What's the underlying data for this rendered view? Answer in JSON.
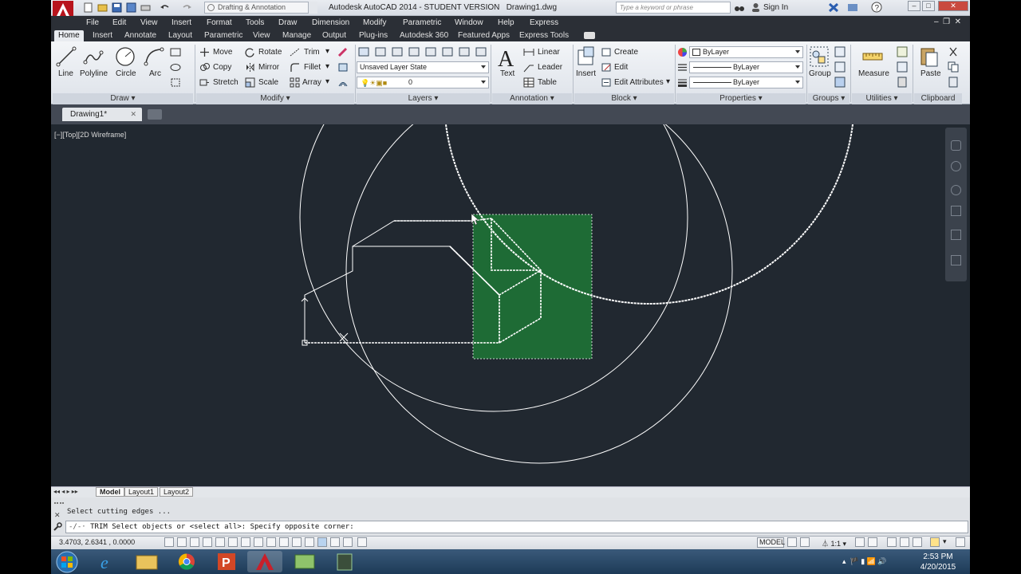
{
  "titlebar": {
    "workspace": "Drafting & Annotation",
    "app_title": "Autodesk AutoCAD 2014 - STUDENT VERSION",
    "file_name": "Drawing1.dwg",
    "search_placeholder": "Type a keyword or phrase",
    "sign_in": "Sign In"
  },
  "menubar": [
    "File",
    "Edit",
    "View",
    "Insert",
    "Format",
    "Tools",
    "Draw",
    "Dimension",
    "Modify",
    "Parametric",
    "Window",
    "Help",
    "Express"
  ],
  "ribbon_tabs": [
    "Home",
    "Insert",
    "Annotate",
    "Layout",
    "Parametric",
    "View",
    "Manage",
    "Output",
    "Plug-ins",
    "Autodesk 360",
    "Featured Apps",
    "Express Tools"
  ],
  "ribbon": {
    "draw": {
      "title": "Draw",
      "line": "Line",
      "polyline": "Polyline",
      "circle": "Circle",
      "arc": "Arc"
    },
    "modify": {
      "title": "Modify",
      "move": "Move",
      "rotate": "Rotate",
      "trim": "Trim",
      "copy": "Copy",
      "mirror": "Mirror",
      "fillet": "Fillet",
      "stretch": "Stretch",
      "scale": "Scale",
      "array": "Array"
    },
    "layers": {
      "title": "Layers",
      "layer_state": "Unsaved Layer State",
      "current_layer": "0"
    },
    "annotation": {
      "title": "Annotation",
      "text": "Text",
      "linear": "Linear",
      "leader": "Leader",
      "table": "Table"
    },
    "block": {
      "title": "Block",
      "insert": "Insert",
      "create": "Create",
      "edit": "Edit",
      "edit_attributes": "Edit Attributes"
    },
    "properties": {
      "title": "Properties",
      "color": "ByLayer",
      "linetype": "ByLayer",
      "lineweight": "ByLayer"
    },
    "groups": {
      "title": "Groups",
      "group": "Group"
    },
    "utilities": {
      "title": "Utilities",
      "measure": "Measure"
    },
    "clipboard": {
      "title": "Clipboard",
      "paste": "Paste"
    }
  },
  "file_tab": "Drawing1*",
  "viewport_label": "[−][Top][2D Wireframe]",
  "layout_tabs": [
    "Model",
    "Layout1",
    "Layout2"
  ],
  "command": {
    "history": "Select cutting edges ...",
    "current": "TRIM Select objects or <select all>: Specify opposite corner:"
  },
  "status": {
    "coordinates": "3.4703, 2.6341 , 0.0000",
    "model": "MODEL",
    "scale": "1:1"
  },
  "clock": {
    "time": "2:53 PM",
    "date": "4/20/2015"
  },
  "colors": {
    "viewport_bg": "#212830",
    "selection_fill": "#1e6b35",
    "accent_red": "#c8202a"
  }
}
